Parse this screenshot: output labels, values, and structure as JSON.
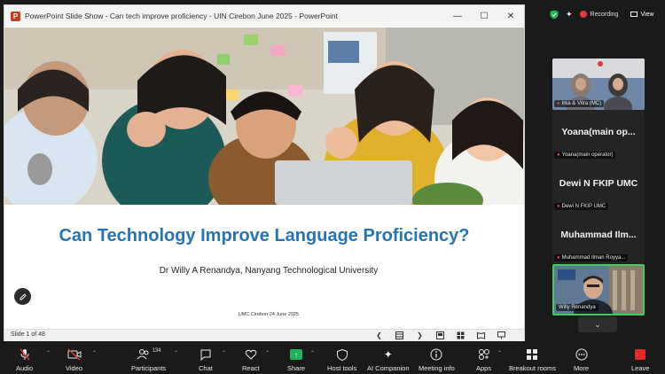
{
  "ppt": {
    "window_title": "PowerPoint Slide Show  -  Can tech improve proficiency  -  UIN Cirebon June 2025  -  PowerPoint",
    "slide": {
      "title": "Can Technology Improve Language Proficiency?",
      "author": "Dr Willy A Renandya, Nanyang Technological University",
      "footer": "UMC Cirebon 24 June 2025"
    },
    "status": {
      "slide_count": "Slide 1 of 48"
    }
  },
  "zoom": {
    "recording_label": "Recording",
    "view_label": "View",
    "participants": [
      {
        "tag": "Irka & Vitra (MC)"
      },
      {
        "name": "Yoana(main  op...",
        "tag": "Yoana(main operator)"
      },
      {
        "name": "Dewi N FKIP UMC",
        "tag": "Dewi N FKIP UMC"
      },
      {
        "name": "Muhammad  Ilm...",
        "tag": "Muhammad Ilman Royya..."
      },
      {
        "tag": "Willy Renandya"
      }
    ],
    "toolbar": {
      "audio": "Audio",
      "video": "Video",
      "participants": "Participants",
      "participants_count": "134",
      "chat": "Chat",
      "react": "React",
      "share": "Share",
      "host_tools": "Host tools",
      "ai_companion": "AI Companion",
      "meeting_info": "Meeting info",
      "apps": "Apps",
      "breakout_rooms": "Breakout rooms",
      "more": "More",
      "leave": "Leave"
    },
    "colors": {
      "share_green": "#20b25a",
      "active_speaker": "#3ecf5a",
      "leave_red": "#e02b2b",
      "title_blue": "#2574b8"
    }
  }
}
